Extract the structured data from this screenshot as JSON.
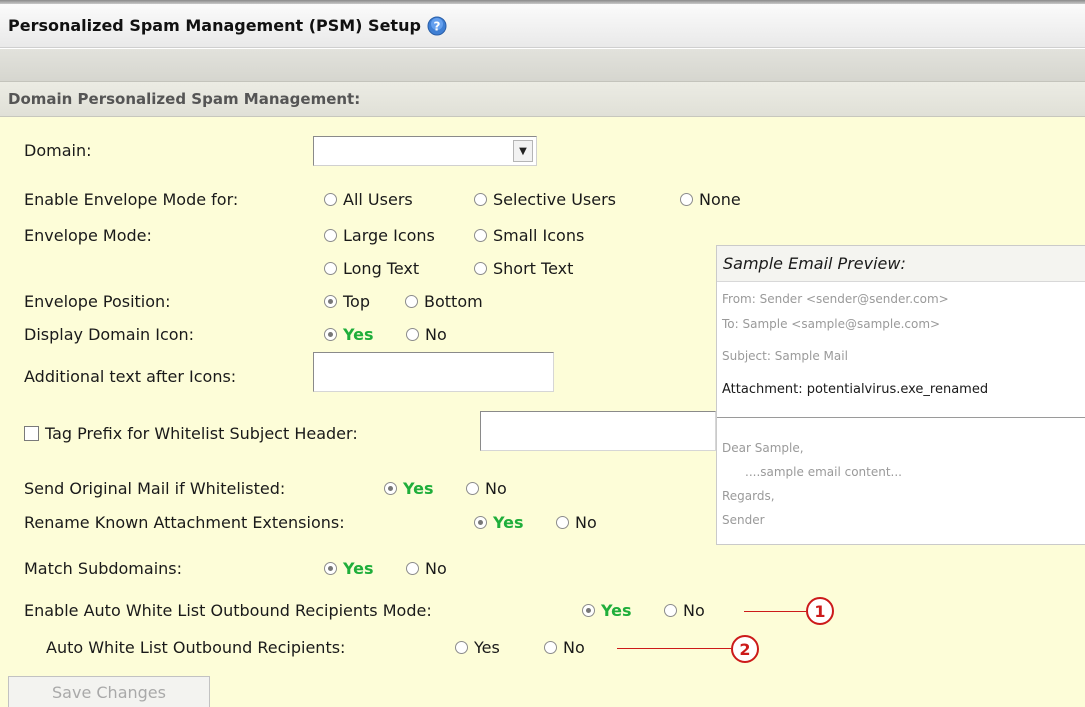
{
  "header": {
    "title": "Personalized Spam Management (PSM) Setup",
    "help_icon": "help-icon"
  },
  "section": {
    "title": "Domain Personalized Spam Management:"
  },
  "fields": {
    "domain_label": "Domain:",
    "domain_value": "",
    "envelope_enable_label": "Enable Envelope Mode for:",
    "envelope_enable_options": [
      "All Users",
      "Selective Users",
      "None"
    ],
    "envelope_mode_label": "Envelope Mode:",
    "envelope_mode_options": [
      "Large Icons",
      "Small Icons",
      "Long Text",
      "Short Text"
    ],
    "envelope_position_label": "Envelope Position:",
    "envelope_position_options": [
      "Top",
      "Bottom"
    ],
    "display_icon_label": "Display Domain Icon:",
    "additional_text_label": "Additional text after Icons:",
    "additional_text_value": "",
    "tag_prefix_label": "Tag Prefix for Whitelist Subject Header:",
    "tag_prefix_value": "",
    "send_original_label": "Send Original Mail if Whitelisted:",
    "rename_attach_label": "Rename Known Attachment Extensions:",
    "match_subdomains_label": "Match Subdomains:",
    "auto_whitelist_mode_label": "Enable Auto White List Outbound Recipients Mode:",
    "auto_whitelist_label": "Auto White List Outbound Recipients:",
    "yes": "Yes",
    "no": "No"
  },
  "preview": {
    "title": "Sample Email Preview:",
    "from": "From: Sender <sender@sender.com>",
    "to": "To: Sample <sample@sample.com>",
    "subject": "Subject: Sample Mail",
    "attachment": "Attachment: potentialvirus.exe_renamed",
    "greeting": "Dear Sample,",
    "content": "....sample email content...",
    "closing": "Regards,",
    "signature": "Sender"
  },
  "buttons": {
    "save": "Save Changes"
  },
  "callouts": [
    "1",
    "2"
  ],
  "colors": {
    "panel": "#fdfdd8",
    "yes": "#1fae3b",
    "callout": "#cc1a1a"
  }
}
